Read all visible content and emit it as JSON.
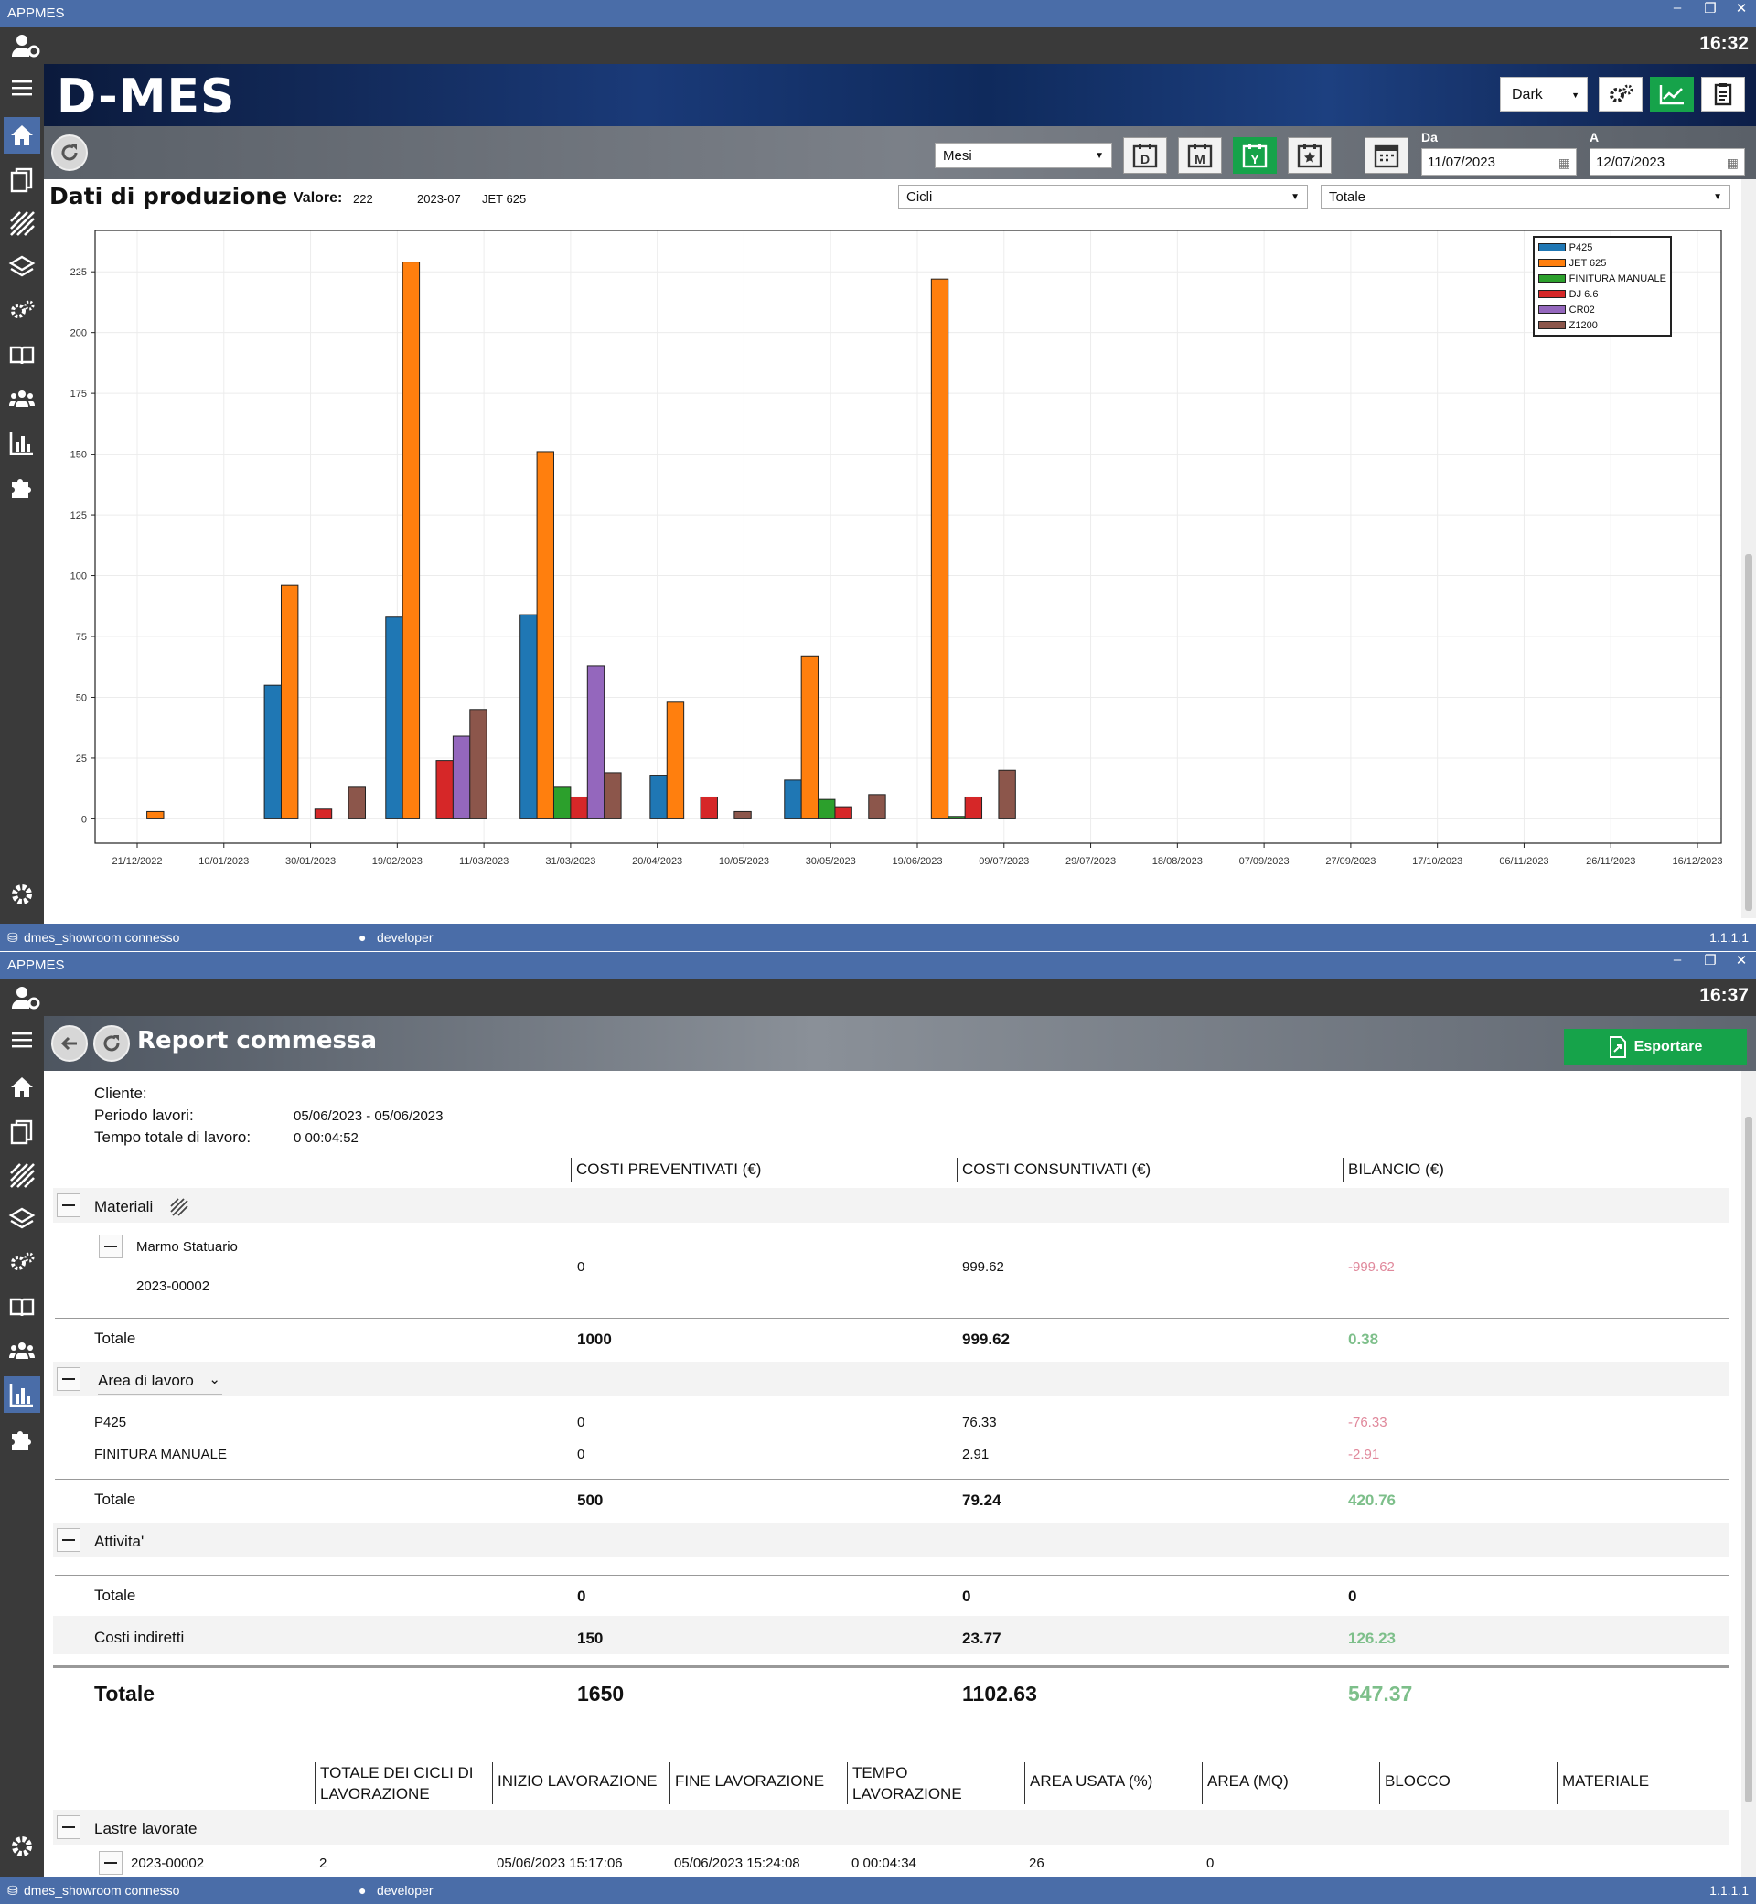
{
  "app": {
    "title": "APPMES"
  },
  "window1": {
    "clock": "16:32",
    "logo": "D-MES",
    "theme": "Dark",
    "period_select": "Mesi",
    "period_buttons": [
      "D",
      "M",
      "Y"
    ],
    "date_from_label": "Da",
    "date_from": "11/07/2023",
    "date_to_label": "A",
    "date_to": "12/07/2023",
    "section_title": "Dati di produzione",
    "valore_label": "Valore:",
    "valore": "222",
    "valore_period": "2023-07",
    "valore_series": "JET 625",
    "metric_select": "Cicli",
    "aggregate_select": "Totale",
    "status_db": "dmes_showroom connesso",
    "status_user": "developer",
    "version": "1.1.1.1"
  },
  "chart_data": {
    "type": "bar",
    "title": "",
    "xlabel": "",
    "ylabel": "",
    "ylim": [
      -10,
      242
    ],
    "yticks": [
      0,
      25,
      50,
      75,
      100,
      125,
      150,
      175,
      200,
      225
    ],
    "x_ticks": [
      "21/12/2022",
      "10/01/2023",
      "30/01/2023",
      "19/02/2023",
      "11/03/2023",
      "31/03/2023",
      "20/04/2023",
      "10/05/2023",
      "30/05/2023",
      "19/06/2023",
      "09/07/2023",
      "29/07/2023",
      "18/08/2023",
      "07/09/2023",
      "27/09/2023",
      "17/10/2023",
      "06/11/2023",
      "26/11/2023",
      "16/12/2023"
    ],
    "categories": [
      "2022-12",
      "2023-01",
      "2023-02",
      "2023-03",
      "2023-04",
      "2023-05",
      "2023-06",
      "2023-07"
    ],
    "category_dates": [
      "2022-12-31",
      "2023-01-31",
      "2023-02-28",
      "2023-03-31",
      "2023-04-30",
      "2023-05-31",
      "2023-06-30",
      "2023-07-31"
    ],
    "series": [
      {
        "name": "P425",
        "color": "#1f77b4",
        "values": [
          null,
          55,
          83,
          84,
          18,
          16,
          null,
          null
        ]
      },
      {
        "name": "JET 625",
        "color": "#ff7f0e",
        "values": [
          3,
          96,
          229,
          151,
          48,
          67,
          222,
          null
        ]
      },
      {
        "name": "FINITURA MANUALE",
        "color": "#2ca02c",
        "values": [
          null,
          null,
          null,
          13,
          null,
          8,
          1,
          null
        ]
      },
      {
        "name": "DJ 6.6",
        "color": "#d62728",
        "values": [
          null,
          4,
          24,
          9,
          9,
          5,
          9,
          null
        ]
      },
      {
        "name": "CR02",
        "color": "#9467bd",
        "values": [
          null,
          null,
          34,
          63,
          null,
          null,
          null,
          null
        ]
      },
      {
        "name": "Z1200",
        "color": "#8c564b",
        "values": [
          null,
          13,
          45,
          19,
          3,
          10,
          20,
          null
        ]
      }
    ],
    "grid": true,
    "legend_position": "top-right"
  },
  "window2": {
    "clock": "16:37",
    "title": "Report commessa",
    "export_label": "Esportare",
    "cliente_label": "Cliente:",
    "cliente": "",
    "periodo_label": "Periodo lavori:",
    "periodo": "05/06/2023 - 05/06/2023",
    "tempo_label": "Tempo totale di lavoro:",
    "tempo": "0 00:04:52",
    "col_prev": "COSTI PREVENTIVATI (€)",
    "col_cons": "COSTI CONSUNTIVATI (€)",
    "col_bil": "BILANCIO (€)",
    "materiali": {
      "label": "Materiali",
      "item_name": "Marmo Statuario",
      "item_code": "2023-00002",
      "item_prev": "0",
      "item_cons": "999.62",
      "item_bil": "-999.62",
      "tot_label": "Totale",
      "tot_prev": "1000",
      "tot_cons": "999.62",
      "tot_bil": "0.38"
    },
    "area": {
      "label": "Area di lavoro",
      "rows": [
        {
          "name": "P425",
          "prev": "0",
          "cons": "76.33",
          "bil": "-76.33"
        },
        {
          "name": "FINITURA MANUALE",
          "prev": "0",
          "cons": "2.91",
          "bil": "-2.91"
        }
      ],
      "tot_label": "Totale",
      "tot_prev": "500",
      "tot_cons": "79.24",
      "tot_bil": "420.76"
    },
    "attivita": {
      "label": "Attivita'",
      "tot_label": "Totale",
      "tot_prev": "0",
      "tot_cons": "0",
      "tot_bil": "0"
    },
    "indiretti": {
      "label": "Costi indiretti",
      "prev": "150",
      "cons": "23.77",
      "bil": "126.23"
    },
    "grand": {
      "label": "Totale",
      "prev": "1650",
      "cons": "1102.63",
      "bil": "547.37"
    },
    "lastre_cols": [
      "TOTALE DEI CICLI DI LAVORAZIONE",
      "INIZIO LAVORAZIONE",
      "FINE LAVORAZIONE",
      "TEMPO LAVORAZIONE",
      "AREA USATA (%)",
      "AREA (MQ)",
      "BLOCCO",
      "MATERIALE"
    ],
    "lastre": {
      "label": "Lastre lavorate",
      "row": {
        "code": "2023-00002",
        "cicli": "2",
        "inizio": "05/06/2023 15:17:06",
        "fine": "05/06/2023 15:24:08",
        "tempo": "0 00:04:34",
        "area_pct": "26",
        "area_mq": "0",
        "blocco": "",
        "materiale": ""
      }
    },
    "status_db": "dmes_showroom connesso",
    "status_user": "developer",
    "version": "1.1.1.1"
  }
}
